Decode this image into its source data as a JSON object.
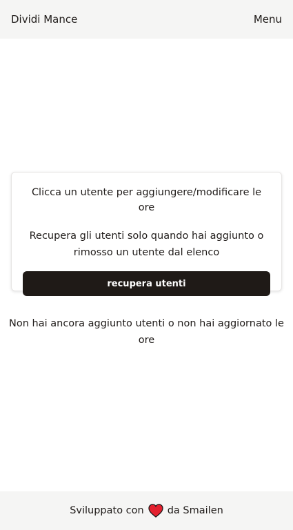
{
  "header": {
    "brand": "Dividi Mance",
    "menu_label": "Menu"
  },
  "card": {
    "instruction": "Clicca un utente per aggiungere/modificare le ore",
    "note": "Recupera gli utenti solo quando hai aggiunto o rimosso un utente dal elenco",
    "button_label": "recupera utenti"
  },
  "empty_state": {
    "message": "Non hai ancora aggiunto utenti o non hai aggiornato le ore"
  },
  "footer": {
    "prefix": "Sviluppato con",
    "icon": "heart-icon",
    "suffix": "da Smailen"
  },
  "colors": {
    "bar_background": "#f5f5f4",
    "button_background": "#1f1a17",
    "heart": "#e3212f"
  }
}
